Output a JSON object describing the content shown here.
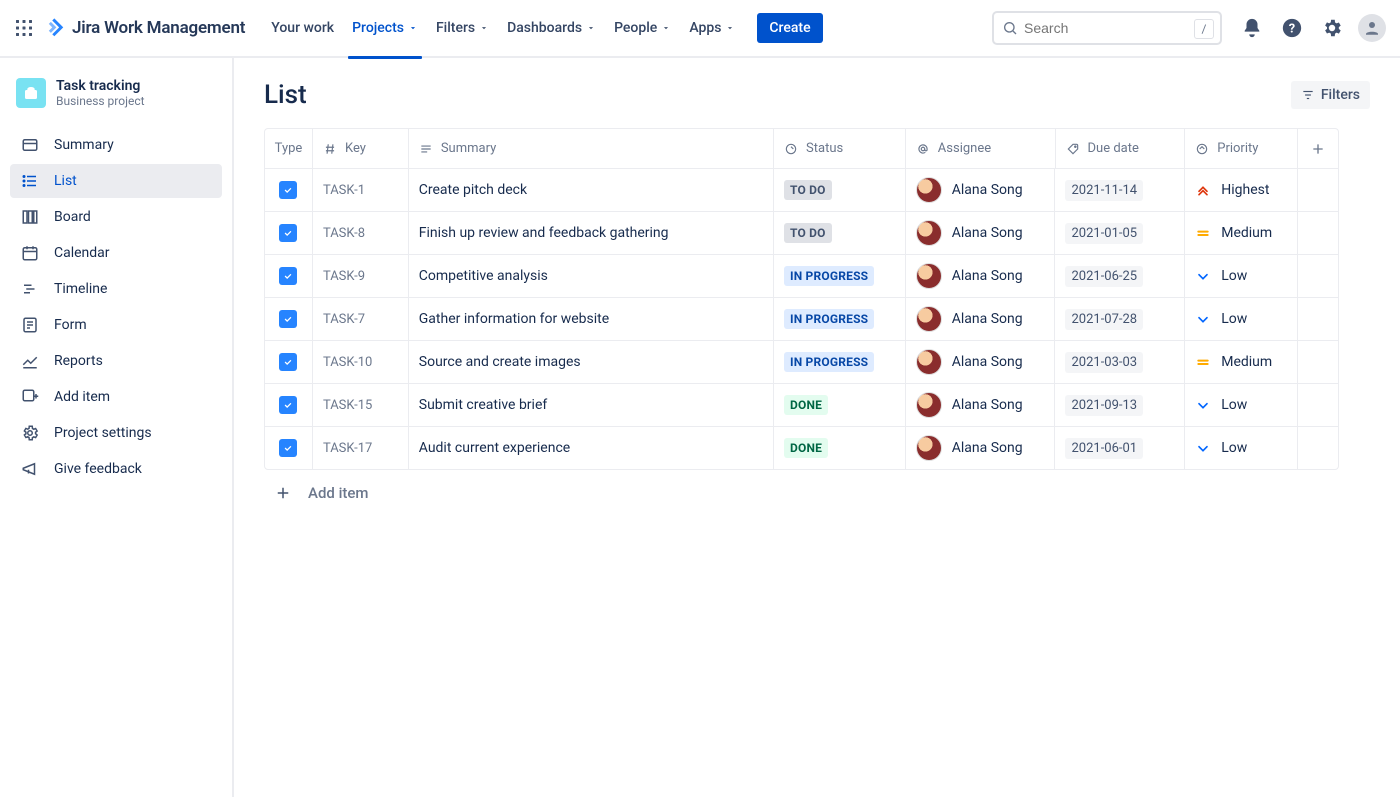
{
  "brand": "Jira Work Management",
  "nav": {
    "items": [
      "Your work",
      "Projects",
      "Filters",
      "Dashboards",
      "People",
      "Apps"
    ],
    "active_index": 1,
    "create": "Create",
    "search_placeholder": "Search",
    "slash_hint": "/"
  },
  "project": {
    "name": "Task tracking",
    "subtitle": "Business project"
  },
  "sidebar": {
    "items": [
      {
        "icon": "summary",
        "label": "Summary"
      },
      {
        "icon": "list",
        "label": "List",
        "active": true
      },
      {
        "icon": "board",
        "label": "Board"
      },
      {
        "icon": "calendar",
        "label": "Calendar"
      },
      {
        "icon": "timeline",
        "label": "Timeline"
      },
      {
        "icon": "form",
        "label": "Form"
      },
      {
        "icon": "reports",
        "label": "Reports"
      },
      {
        "icon": "additem",
        "label": "Add item"
      },
      {
        "icon": "settings",
        "label": "Project settings"
      },
      {
        "icon": "feedback",
        "label": "Give feedback"
      }
    ]
  },
  "page": {
    "title": "List",
    "filters_label": "Filters"
  },
  "columns": {
    "type": "Type",
    "key": "Key",
    "summary": "Summary",
    "status": "Status",
    "assignee": "Assignee",
    "due": "Due date",
    "priority": "Priority"
  },
  "rows": [
    {
      "key": "TASK-1",
      "summary": "Create pitch deck",
      "status": "TO DO",
      "status_kind": "todo",
      "assignee": "Alana Song",
      "due": "2021-11-14",
      "priority": "Highest",
      "prio_kind": "highest"
    },
    {
      "key": "TASK-8",
      "summary": "Finish up review and feedback gathering",
      "status": "TO DO",
      "status_kind": "todo",
      "assignee": "Alana Song",
      "due": "2021-01-05",
      "priority": "Medium",
      "prio_kind": "medium"
    },
    {
      "key": "TASK-9",
      "summary": "Competitive analysis",
      "status": "IN PROGRESS",
      "status_kind": "inprogress",
      "assignee": "Alana Song",
      "due": "2021-06-25",
      "priority": "Low",
      "prio_kind": "low"
    },
    {
      "key": "TASK-7",
      "summary": "Gather information for website",
      "status": "IN PROGRESS",
      "status_kind": "inprogress",
      "assignee": "Alana Song",
      "due": "2021-07-28",
      "priority": "Low",
      "prio_kind": "low"
    },
    {
      "key": "TASK-10",
      "summary": "Source and create images",
      "status": "IN PROGRESS",
      "status_kind": "inprogress",
      "assignee": "Alana Song",
      "due": "2021-03-03",
      "priority": "Medium",
      "prio_kind": "medium"
    },
    {
      "key": "TASK-15",
      "summary": "Submit creative brief",
      "status": "DONE",
      "status_kind": "done",
      "assignee": "Alana Song",
      "due": "2021-09-13",
      "priority": "Low",
      "prio_kind": "low"
    },
    {
      "key": "TASK-17",
      "summary": "Audit current experience",
      "status": "DONE",
      "status_kind": "done",
      "assignee": "Alana Song",
      "due": "2021-06-01",
      "priority": "Low",
      "prio_kind": "low"
    }
  ],
  "add_item_label": "Add item"
}
